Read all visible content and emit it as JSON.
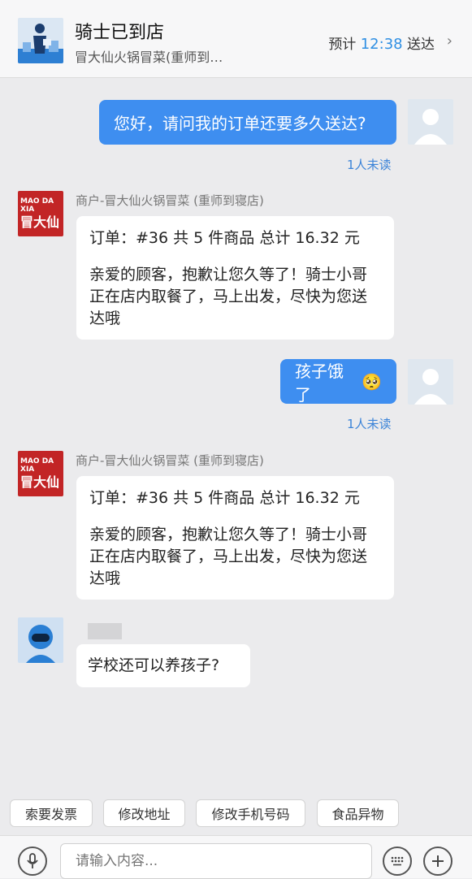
{
  "header": {
    "title": "骑士已到店",
    "subtitle": "冒大仙火锅冒菜(重师到…",
    "eta_prefix": "预计",
    "eta_time": "12:38",
    "eta_suffix": "送达",
    "chevron": "›"
  },
  "messages": [
    {
      "text": "您好，请问我的订单还要多久送达?",
      "status": "1人未读"
    },
    {
      "sender": "商户-冒大仙火锅冒菜 (重师到寝店)",
      "logo_top": "MAO DA XIA",
      "logo_main": "冒大仙",
      "line1": "订单：#36 共 5 件商品 总计 16.32 元",
      "line2": "亲爱的顾客，抱歉让您久等了！骑士小哥正在店内取餐了，马上出发，尽快为您送达哦"
    },
    {
      "text": "孩子饿了",
      "emoji": "🥺",
      "status": "1人未读"
    },
    {
      "sender": "商户-冒大仙火锅冒菜 (重师到寝店)",
      "logo_top": "MAO DA XIA",
      "logo_main": "冒大仙",
      "line1": "订单：#36 共 5 件商品 总计 16.32 元",
      "line2": "亲爱的顾客，抱歉让您久等了！骑士小哥正在店内取餐了，马上出发，尽快为您送达哦"
    },
    {
      "text": "学校还可以养孩子?"
    }
  ],
  "quick_replies": [
    "索要发票",
    "修改地址",
    "修改手机号码",
    "食品异物"
  ],
  "input": {
    "placeholder": "请输入内容..."
  },
  "icons": {
    "voice": "microphone-icon",
    "keyboard": "keyboard-icon",
    "add": "plus-icon"
  },
  "colors": {
    "accent": "#3e8ef0",
    "eta_time": "#2f8fe3",
    "unread": "#3c84d8",
    "merchant_logo": "#c22526",
    "background": "#ebebed"
  }
}
